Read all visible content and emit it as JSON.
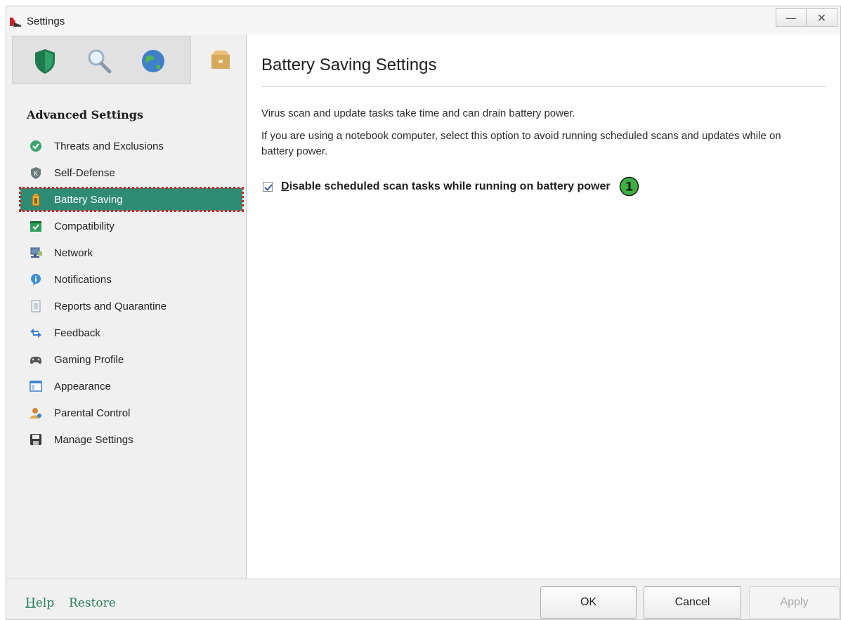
{
  "window": {
    "title": "Settings",
    "minimize_glyph": "—",
    "close_glyph": "✕"
  },
  "sidebar": {
    "categories": [
      {
        "name": "protection",
        "icon": "shield-icon"
      },
      {
        "name": "scan",
        "icon": "magnifier-icon"
      },
      {
        "name": "update",
        "icon": "globe-icon"
      },
      {
        "name": "advanced",
        "icon": "box-icon",
        "active": true
      }
    ],
    "section_title": "Advanced Settings",
    "items": [
      {
        "label": "Threats and Exclusions",
        "icon": "check-circle-icon"
      },
      {
        "label": "Self-Defense",
        "icon": "k-shield-icon"
      },
      {
        "label": "Battery Saving",
        "icon": "battery-icon",
        "selected": true
      },
      {
        "label": "Compatibility",
        "icon": "calendar-check-icon"
      },
      {
        "label": "Network",
        "icon": "network-icon"
      },
      {
        "label": "Notifications",
        "icon": "info-icon"
      },
      {
        "label": "Reports and Quarantine",
        "icon": "report-icon"
      },
      {
        "label": "Feedback",
        "icon": "arrows-icon"
      },
      {
        "label": "Gaming Profile",
        "icon": "gamepad-icon"
      },
      {
        "label": "Appearance",
        "icon": "window-icon"
      },
      {
        "label": "Parental Control",
        "icon": "user-icon"
      },
      {
        "label": "Manage Settings",
        "icon": "floppy-icon"
      }
    ]
  },
  "main": {
    "title": "Battery Saving Settings",
    "desc1": "Virus scan and update tasks take time and can drain battery power.",
    "desc2": "If you are using a notebook computer, select this option to avoid running scheduled scans and updates while on battery power.",
    "checkbox": {
      "label_first": "D",
      "label_rest": "isable scheduled scan tasks while running on battery power",
      "checked": true,
      "badge": "1"
    }
  },
  "footer": {
    "help_first": "H",
    "help_rest": "elp",
    "restore": "Restore",
    "ok": "OK",
    "cancel": "Cancel",
    "apply": "Apply"
  },
  "colors": {
    "accent": "#2e8b74",
    "link": "#2a7d5e",
    "highlight_border": "#d42323",
    "badge": "#3cb043"
  }
}
